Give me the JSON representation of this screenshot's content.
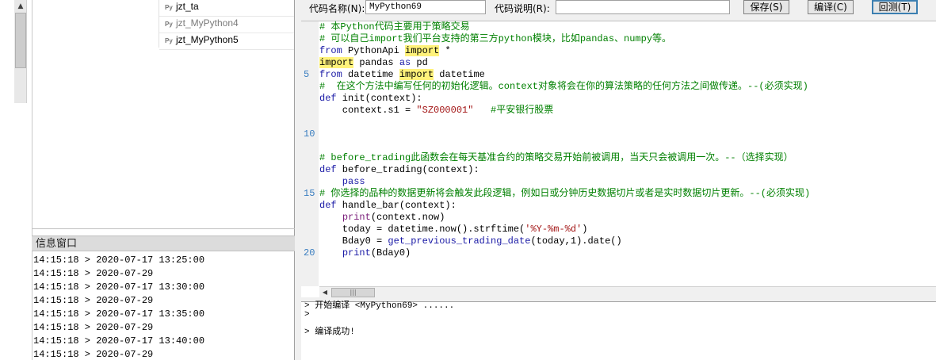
{
  "file_list": [
    {
      "name": "jzt_ta",
      "icon": "python-file-icon",
      "dim": false
    },
    {
      "name": "jzt_MyPython4",
      "icon": "python-file-icon",
      "dim": true
    },
    {
      "name": "jzt_MyPython5",
      "icon": "python-file-icon",
      "dim": false
    }
  ],
  "info_panel": {
    "title": "信息窗口",
    "lines": [
      "14:15:18 > 2020-07-17 13:25:00",
      "14:15:18 > 2020-07-29",
      "14:15:18 > 2020-07-17 13:30:00",
      "14:15:18 > 2020-07-29",
      "14:15:18 > 2020-07-17 13:35:00",
      "14:15:18 > 2020-07-29",
      "14:15:18 > 2020-07-17 13:40:00",
      "14:15:18 > 2020-07-29"
    ]
  },
  "toolbar": {
    "code_name_label": "代码名称(N):",
    "code_name_value": "MyPython69",
    "code_desc_label": "代码说明(R):",
    "code_desc_value": "",
    "save_label": "保存(S)",
    "compile_label": "编译(C)",
    "backtest_label": "回测(T)"
  },
  "editor": {
    "line_numbers": [
      "5",
      "10",
      "15",
      "20"
    ],
    "lines": [
      [
        {
          "t": "# 本Python代码主要用于策略交易",
          "c": "cm"
        }
      ],
      [
        {
          "t": "# 可以自己import我们平台支持的第三方python模块，比如pandas、numpy等。",
          "c": "cm"
        }
      ],
      [
        {
          "t": "from",
          "c": "kw"
        },
        {
          "t": " PythonApi ",
          "c": ""
        },
        {
          "t": "import",
          "c": "hl"
        },
        {
          "t": " *",
          "c": ""
        }
      ],
      [
        {
          "t": "import",
          "c": "hl"
        },
        {
          "t": " pandas ",
          "c": ""
        },
        {
          "t": "as",
          "c": "kw"
        },
        {
          "t": " pd",
          "c": ""
        }
      ],
      [
        {
          "t": "from",
          "c": "kw"
        },
        {
          "t": " datetime ",
          "c": ""
        },
        {
          "t": "import",
          "c": "hl"
        },
        {
          "t": " datetime",
          "c": ""
        }
      ],
      [
        {
          "t": "#  在这个方法中编写任何的初始化逻辑。context对象将会在你的算法策略的任何方法之间做传递。--(必须实现)",
          "c": "cm"
        }
      ],
      [
        {
          "t": "def",
          "c": "kw"
        },
        {
          "t": " init(context):",
          "c": ""
        }
      ],
      [
        {
          "t": "    context.s1 = ",
          "c": ""
        },
        {
          "t": "\"SZ000001\"",
          "c": "str"
        },
        {
          "t": "   ",
          "c": ""
        },
        {
          "t": "#平安银行股票",
          "c": "cm"
        }
      ],
      [
        {
          "t": "",
          "c": ""
        }
      ],
      [
        {
          "t": "",
          "c": ""
        }
      ],
      [
        {
          "t": "",
          "c": ""
        }
      ],
      [
        {
          "t": "# before_trading此函数会在每天基准合约的策略交易开始前被调用，当天只会被调用一次。--（选择实现）",
          "c": "cm"
        }
      ],
      [
        {
          "t": "def",
          "c": "kw"
        },
        {
          "t": " before_trading(context):",
          "c": ""
        }
      ],
      [
        {
          "t": "    pass",
          "c": "kw"
        }
      ],
      [
        {
          "t": "# 你选择的品种的数据更新将会触发此段逻辑，例如日或分钟历史数据切片或者是实时数据切片更新。--(必须实现)",
          "c": "cm"
        }
      ],
      [
        {
          "t": "def",
          "c": "kw"
        },
        {
          "t": " handle_bar(context):",
          "c": ""
        }
      ],
      [
        {
          "t": "    ",
          "c": ""
        },
        {
          "t": "print",
          "c": "pr"
        },
        {
          "t": "(context.now)",
          "c": ""
        }
      ],
      [
        {
          "t": "    today = datetime.now().strftime(",
          "c": ""
        },
        {
          "t": "'%Y-%m-%d'",
          "c": "str"
        },
        {
          "t": ")",
          "c": ""
        }
      ],
      [
        {
          "t": "    Bday0 = ",
          "c": ""
        },
        {
          "t": "get_previous_trading_date",
          "c": "kw"
        },
        {
          "t": "(today,1).date()",
          "c": ""
        }
      ],
      [
        {
          "t": "    ",
          "c": ""
        },
        {
          "t": "print",
          "c": "kw"
        },
        {
          "t": "(Bday0)",
          "c": ""
        }
      ]
    ]
  },
  "output": {
    "lines": [
      "> 开始编译 <MyPython69> ......",
      ">",
      "",
      "> 编译成功!"
    ]
  }
}
